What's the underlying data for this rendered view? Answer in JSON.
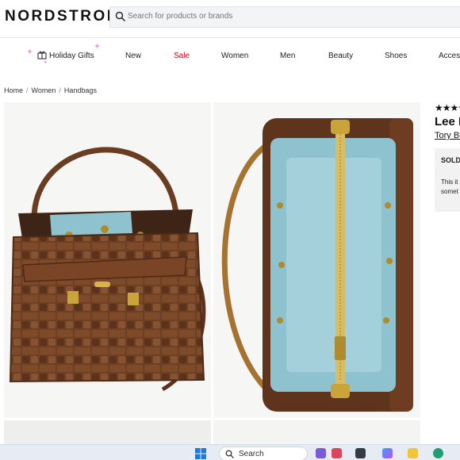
{
  "header": {
    "logo": "NORDSTROM",
    "search_placeholder": "Search for products or brands"
  },
  "nav": {
    "items": [
      "Holiday Gifts",
      "New",
      "Sale",
      "Women",
      "Men",
      "Beauty",
      "Shoes",
      "Accessories"
    ]
  },
  "breadcrumb": [
    "Home",
    "Women",
    "Handbags"
  ],
  "product": {
    "stars": "★★★★★",
    "title_visible": "Lee R",
    "brand_visible": "Tory Bu",
    "sold_visible": "SOLD",
    "sold_note_line1": "This it",
    "sold_note_line2": "somet"
  },
  "taskbar": {
    "search_label": "Search"
  },
  "colors": {
    "sale": "#d6001c",
    "bag_leather": "#6b3d22",
    "bag_lining": "#8ec2cf",
    "taskbar": "#e7ecf4"
  },
  "icons": [
    "search-icon",
    "gift-icon",
    "windows-start-icon",
    "taskbar-search-icon"
  ]
}
